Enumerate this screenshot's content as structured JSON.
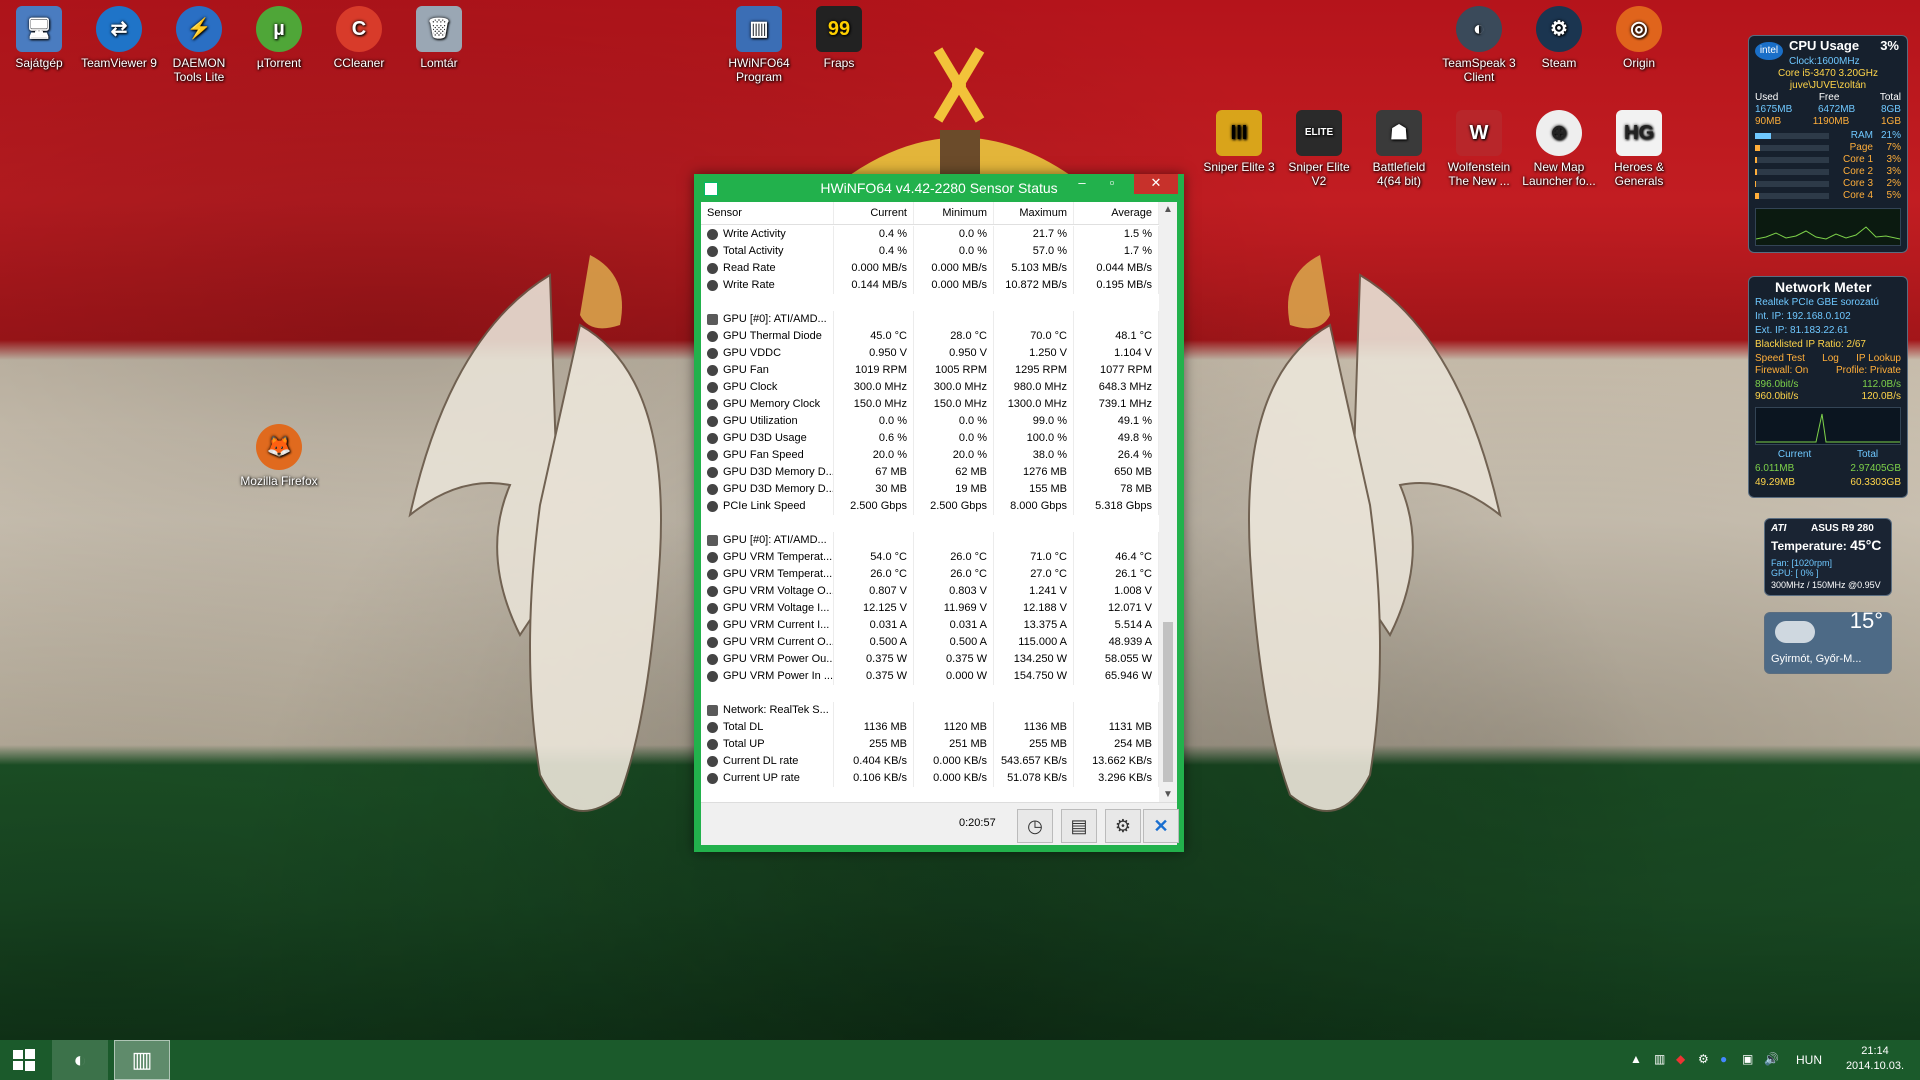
{
  "desktop": {
    "icons_top_left": [
      "Sajátgép",
      "TeamViewer 9",
      "DAEMON Tools Lite",
      "µTorrent",
      "CCleaner",
      "Lomtár"
    ],
    "icons_top_center": [
      "HWiNFO64 Program",
      "Fraps"
    ],
    "icons_top_right": [
      "TeamSpeak 3 Client",
      "Steam",
      "Origin"
    ],
    "icons_row2_right": [
      "Sniper Elite 3",
      "Sniper Elite V2",
      "Battlefield 4(64 bit)",
      "Wolfenstein The New ...",
      "New Map Launcher fo...",
      "Heroes & Generals"
    ],
    "firefox": "Mozilla Firefox",
    "fraps_counter": "99"
  },
  "window": {
    "title": "HWiNFO64 v4.42-2280 Sensor Status",
    "columns": [
      "Sensor",
      "Current",
      "Minimum",
      "Maximum",
      "Average"
    ],
    "rows": [
      {
        "name": "Write Activity",
        "cur": "0.4 %",
        "min": "0.0 %",
        "max": "21.7 %",
        "avg": "1.5 %"
      },
      {
        "name": "Total Activity",
        "cur": "0.4 %",
        "min": "0.0 %",
        "max": "57.0 %",
        "avg": "1.7 %"
      },
      {
        "name": "Read Rate",
        "cur": "0.000 MB/s",
        "min": "0.000 MB/s",
        "max": "5.103 MB/s",
        "avg": "0.044 MB/s"
      },
      {
        "name": "Write Rate",
        "cur": "0.144 MB/s",
        "min": "0.000 MB/s",
        "max": "10.872 MB/s",
        "avg": "0.195 MB/s"
      },
      {
        "blank": true
      },
      {
        "group": true,
        "name": "GPU [#0]: ATI/AMD..."
      },
      {
        "name": "GPU Thermal Diode",
        "cur": "45.0 °C",
        "min": "28.0 °C",
        "max": "70.0 °C",
        "avg": "48.1 °C"
      },
      {
        "name": "GPU VDDC",
        "cur": "0.950 V",
        "min": "0.950 V",
        "max": "1.250 V",
        "avg": "1.104 V"
      },
      {
        "name": "GPU Fan",
        "cur": "1019 RPM",
        "min": "1005 RPM",
        "max": "1295 RPM",
        "avg": "1077 RPM"
      },
      {
        "name": "GPU Clock",
        "cur": "300.0 MHz",
        "min": "300.0 MHz",
        "max": "980.0 MHz",
        "avg": "648.3 MHz"
      },
      {
        "name": "GPU Memory Clock",
        "cur": "150.0 MHz",
        "min": "150.0 MHz",
        "max": "1300.0 MHz",
        "avg": "739.1 MHz"
      },
      {
        "name": "GPU Utilization",
        "cur": "0.0 %",
        "min": "0.0 %",
        "max": "99.0 %",
        "avg": "49.1 %"
      },
      {
        "name": "GPU D3D Usage",
        "cur": "0.6 %",
        "min": "0.0 %",
        "max": "100.0 %",
        "avg": "49.8 %"
      },
      {
        "name": "GPU Fan Speed",
        "cur": "20.0 %",
        "min": "20.0 %",
        "max": "38.0 %",
        "avg": "26.4 %"
      },
      {
        "name": "GPU D3D Memory D...",
        "cur": "67 MB",
        "min": "62 MB",
        "max": "1276 MB",
        "avg": "650 MB"
      },
      {
        "name": "GPU D3D Memory D...",
        "cur": "30 MB",
        "min": "19 MB",
        "max": "155 MB",
        "avg": "78 MB"
      },
      {
        "name": "PCIe Link Speed",
        "cur": "2.500 Gbps",
        "min": "2.500 Gbps",
        "max": "8.000 Gbps",
        "avg": "5.318 Gbps"
      },
      {
        "blank": true
      },
      {
        "group": true,
        "name": "GPU [#0]: ATI/AMD..."
      },
      {
        "name": "GPU VRM Temperat...",
        "cur": "54.0 °C",
        "min": "26.0 °C",
        "max": "71.0 °C",
        "avg": "46.4 °C"
      },
      {
        "name": "GPU VRM Temperat...",
        "cur": "26.0 °C",
        "min": "26.0 °C",
        "max": "27.0 °C",
        "avg": "26.1 °C"
      },
      {
        "name": "GPU VRM Voltage O...",
        "cur": "0.807 V",
        "min": "0.803 V",
        "max": "1.241 V",
        "avg": "1.008 V"
      },
      {
        "name": "GPU VRM Voltage I...",
        "cur": "12.125 V",
        "min": "11.969 V",
        "max": "12.188 V",
        "avg": "12.071 V"
      },
      {
        "name": "GPU VRM Current I...",
        "cur": "0.031 A",
        "min": "0.031 A",
        "max": "13.375 A",
        "avg": "5.514 A"
      },
      {
        "name": "GPU VRM Current O...",
        "cur": "0.500 A",
        "min": "0.500 A",
        "max": "115.000 A",
        "avg": "48.939 A"
      },
      {
        "name": "GPU VRM Power Ou...",
        "cur": "0.375 W",
        "min": "0.375 W",
        "max": "134.250 W",
        "avg": "58.055 W"
      },
      {
        "name": "GPU VRM Power In ...",
        "cur": "0.375 W",
        "min": "0.000 W",
        "max": "154.750 W",
        "avg": "65.946 W"
      },
      {
        "blank": true
      },
      {
        "group": true,
        "name": "Network: RealTek S..."
      },
      {
        "name": "Total DL",
        "cur": "1136 MB",
        "min": "1120 MB",
        "max": "1136 MB",
        "avg": "1131 MB"
      },
      {
        "name": "Total UP",
        "cur": "255 MB",
        "min": "251 MB",
        "max": "255 MB",
        "avg": "254 MB"
      },
      {
        "name": "Current DL rate",
        "cur": "0.404 KB/s",
        "min": "0.000 KB/s",
        "max": "543.657 KB/s",
        "avg": "13.662 KB/s"
      },
      {
        "name": "Current UP rate",
        "cur": "0.106 KB/s",
        "min": "0.000 KB/s",
        "max": "51.078 KB/s",
        "avg": "3.296 KB/s"
      }
    ],
    "elapsed": "0:20:57"
  },
  "cpu_gadget": {
    "title": "CPU Usage",
    "percent": "3%",
    "clock": "Clock:1600MHz",
    "cpu": "Core i5-3470 3.20GHz",
    "user": "juve\\JUVE\\zoltán",
    "mem_head": [
      "Used",
      "Free",
      "Total"
    ],
    "ram": [
      "1675MB",
      "6472MB",
      "8GB"
    ],
    "page": [
      "90MB",
      "1190MB",
      "1GB"
    ],
    "bars": [
      {
        "label": "RAM",
        "value": "21%"
      },
      {
        "label": "Page",
        "value": "7%"
      },
      {
        "label": "Core 1",
        "value": "3%"
      },
      {
        "label": "Core 2",
        "value": "3%"
      },
      {
        "label": "Core 3",
        "value": "2%"
      },
      {
        "label": "Core 4",
        "value": "5%"
      }
    ]
  },
  "net_gadget": {
    "title": "Network Meter",
    "adapter": "Realtek PCIe GBE sorozatú",
    "int_ip": "Int. IP: 192.168.0.102",
    "ext_ip": "Ext. IP: 81.183.22.61",
    "blacklist": "Blacklisted IP Ratio: 2/67",
    "links": [
      "Speed Test",
      "Log",
      "IP Lookup"
    ],
    "firewall": "Firewall: On",
    "profile": "Profile: Private",
    "up_rate": "896.0bit/s",
    "up_total": "112.0B/s",
    "down_rate": "960.0bit/s",
    "down_total": "120.0B/s",
    "current_label": "Current",
    "total_label": "Total",
    "cur_up": "6.011MB",
    "tot_up": "2.97405GB",
    "cur_down": "49.29MB",
    "tot_down": "60.3303GB"
  },
  "gpu_gadget": {
    "brand": "ATI",
    "model": "ASUS R9 280",
    "temp_label": "Temperature:",
    "temp": "45°C",
    "fan": "Fan: [1020rpm]",
    "gpu": "GPU: [ 0% ]",
    "clocks": "300MHz / 150MHz @0.95V"
  },
  "weather_gadget": {
    "temp": "15°",
    "location": "Gyirmót, Győr-M..."
  },
  "taskbar": {
    "lang": "HUN",
    "time": "21:14",
    "date": "2014.10.03."
  },
  "colors": {
    "window_border": "#22b14c",
    "close_red": "#c7312b",
    "taskbar": "#1b5a2b"
  }
}
